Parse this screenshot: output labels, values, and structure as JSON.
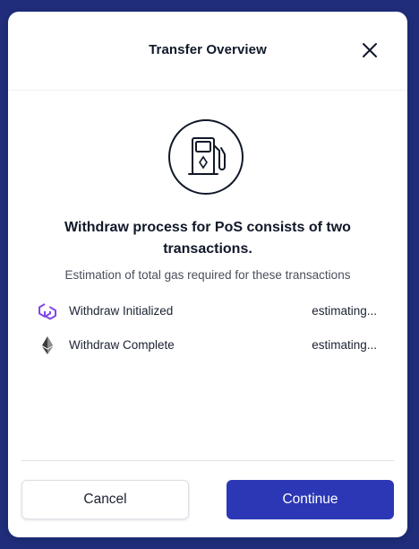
{
  "colors": {
    "backdrop": "#1f2d7a",
    "primary": "#2b37b5",
    "polygon_purple": "#8247e5"
  },
  "dialog": {
    "title": "Transfer Overview",
    "close_icon": "close-icon",
    "hero_icon": "gas-pump-icon"
  },
  "body": {
    "headline": "Withdraw process for PoS consists of two transactions.",
    "subtext": "Estimation of total gas required for these transactions",
    "steps": [
      {
        "icon": "polygon-icon",
        "label": "Withdraw Initialized",
        "value": "estimating..."
      },
      {
        "icon": "ethereum-icon",
        "label": "Withdraw Complete",
        "value": "estimating..."
      }
    ]
  },
  "footer": {
    "cancel_label": "Cancel",
    "continue_label": "Continue"
  }
}
